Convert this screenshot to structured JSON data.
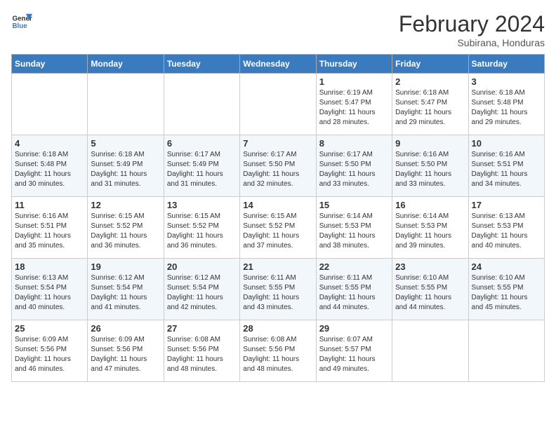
{
  "header": {
    "logo_line1": "General",
    "logo_line2": "Blue",
    "month": "February 2024",
    "location": "Subirana, Honduras"
  },
  "days_of_week": [
    "Sunday",
    "Monday",
    "Tuesday",
    "Wednesday",
    "Thursday",
    "Friday",
    "Saturday"
  ],
  "weeks": [
    [
      {
        "day": "",
        "info": ""
      },
      {
        "day": "",
        "info": ""
      },
      {
        "day": "",
        "info": ""
      },
      {
        "day": "",
        "info": ""
      },
      {
        "day": "1",
        "info": "Sunrise: 6:19 AM\nSunset: 5:47 PM\nDaylight: 11 hours\nand 28 minutes."
      },
      {
        "day": "2",
        "info": "Sunrise: 6:18 AM\nSunset: 5:47 PM\nDaylight: 11 hours\nand 29 minutes."
      },
      {
        "day": "3",
        "info": "Sunrise: 6:18 AM\nSunset: 5:48 PM\nDaylight: 11 hours\nand 29 minutes."
      }
    ],
    [
      {
        "day": "4",
        "info": "Sunrise: 6:18 AM\nSunset: 5:48 PM\nDaylight: 11 hours\nand 30 minutes."
      },
      {
        "day": "5",
        "info": "Sunrise: 6:18 AM\nSunset: 5:49 PM\nDaylight: 11 hours\nand 31 minutes."
      },
      {
        "day": "6",
        "info": "Sunrise: 6:17 AM\nSunset: 5:49 PM\nDaylight: 11 hours\nand 31 minutes."
      },
      {
        "day": "7",
        "info": "Sunrise: 6:17 AM\nSunset: 5:50 PM\nDaylight: 11 hours\nand 32 minutes."
      },
      {
        "day": "8",
        "info": "Sunrise: 6:17 AM\nSunset: 5:50 PM\nDaylight: 11 hours\nand 33 minutes."
      },
      {
        "day": "9",
        "info": "Sunrise: 6:16 AM\nSunset: 5:50 PM\nDaylight: 11 hours\nand 33 minutes."
      },
      {
        "day": "10",
        "info": "Sunrise: 6:16 AM\nSunset: 5:51 PM\nDaylight: 11 hours\nand 34 minutes."
      }
    ],
    [
      {
        "day": "11",
        "info": "Sunrise: 6:16 AM\nSunset: 5:51 PM\nDaylight: 11 hours\nand 35 minutes."
      },
      {
        "day": "12",
        "info": "Sunrise: 6:15 AM\nSunset: 5:52 PM\nDaylight: 11 hours\nand 36 minutes."
      },
      {
        "day": "13",
        "info": "Sunrise: 6:15 AM\nSunset: 5:52 PM\nDaylight: 11 hours\nand 36 minutes."
      },
      {
        "day": "14",
        "info": "Sunrise: 6:15 AM\nSunset: 5:52 PM\nDaylight: 11 hours\nand 37 minutes."
      },
      {
        "day": "15",
        "info": "Sunrise: 6:14 AM\nSunset: 5:53 PM\nDaylight: 11 hours\nand 38 minutes."
      },
      {
        "day": "16",
        "info": "Sunrise: 6:14 AM\nSunset: 5:53 PM\nDaylight: 11 hours\nand 39 minutes."
      },
      {
        "day": "17",
        "info": "Sunrise: 6:13 AM\nSunset: 5:53 PM\nDaylight: 11 hours\nand 40 minutes."
      }
    ],
    [
      {
        "day": "18",
        "info": "Sunrise: 6:13 AM\nSunset: 5:54 PM\nDaylight: 11 hours\nand 40 minutes."
      },
      {
        "day": "19",
        "info": "Sunrise: 6:12 AM\nSunset: 5:54 PM\nDaylight: 11 hours\nand 41 minutes."
      },
      {
        "day": "20",
        "info": "Sunrise: 6:12 AM\nSunset: 5:54 PM\nDaylight: 11 hours\nand 42 minutes."
      },
      {
        "day": "21",
        "info": "Sunrise: 6:11 AM\nSunset: 5:55 PM\nDaylight: 11 hours\nand 43 minutes."
      },
      {
        "day": "22",
        "info": "Sunrise: 6:11 AM\nSunset: 5:55 PM\nDaylight: 11 hours\nand 44 minutes."
      },
      {
        "day": "23",
        "info": "Sunrise: 6:10 AM\nSunset: 5:55 PM\nDaylight: 11 hours\nand 44 minutes."
      },
      {
        "day": "24",
        "info": "Sunrise: 6:10 AM\nSunset: 5:55 PM\nDaylight: 11 hours\nand 45 minutes."
      }
    ],
    [
      {
        "day": "25",
        "info": "Sunrise: 6:09 AM\nSunset: 5:56 PM\nDaylight: 11 hours\nand 46 minutes."
      },
      {
        "day": "26",
        "info": "Sunrise: 6:09 AM\nSunset: 5:56 PM\nDaylight: 11 hours\nand 47 minutes."
      },
      {
        "day": "27",
        "info": "Sunrise: 6:08 AM\nSunset: 5:56 PM\nDaylight: 11 hours\nand 48 minutes."
      },
      {
        "day": "28",
        "info": "Sunrise: 6:08 AM\nSunset: 5:56 PM\nDaylight: 11 hours\nand 48 minutes."
      },
      {
        "day": "29",
        "info": "Sunrise: 6:07 AM\nSunset: 5:57 PM\nDaylight: 11 hours\nand 49 minutes."
      },
      {
        "day": "",
        "info": ""
      },
      {
        "day": "",
        "info": ""
      }
    ]
  ]
}
